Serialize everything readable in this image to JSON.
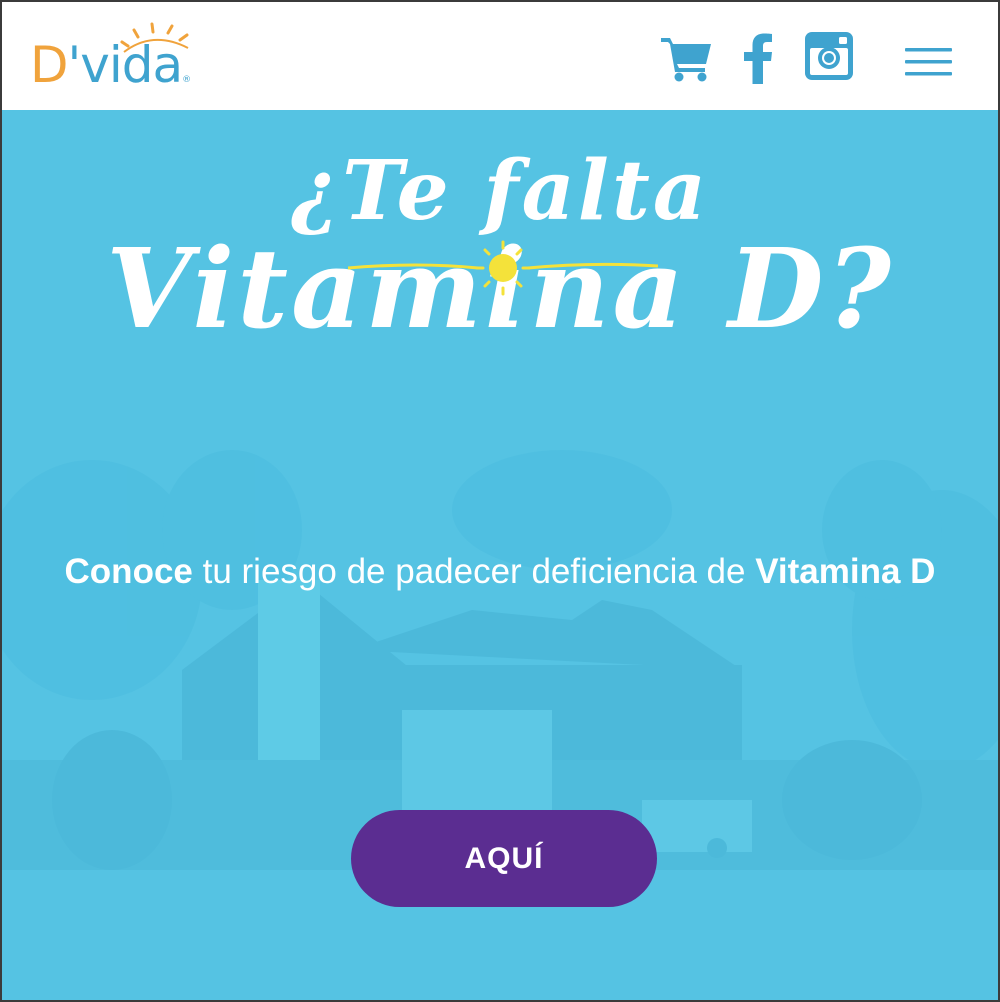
{
  "header": {
    "logo": {
      "first_letter": "D",
      "rest": "'vida",
      "registered": "®"
    },
    "icons": [
      "cart-icon",
      "facebook-icon",
      "instagram-icon",
      "hamburger-menu-icon"
    ]
  },
  "hero": {
    "title_line1": "¿Te falta",
    "title_line2": "Vitamina D?",
    "tagline": {
      "bold1": "Conoce",
      "middle": " tu riesgo de padecer deficiencia de ",
      "bold2": "Vitamina D"
    },
    "cta_label": "AQUÍ"
  },
  "colors": {
    "header_bg": "#ffffff",
    "hero_bg": "#55c3e3",
    "icon_blue": "#3fa3cf",
    "logo_orange": "#f0a33c",
    "cta_purple": "#5b2d91",
    "sun_yellow": "#f4e23a"
  }
}
